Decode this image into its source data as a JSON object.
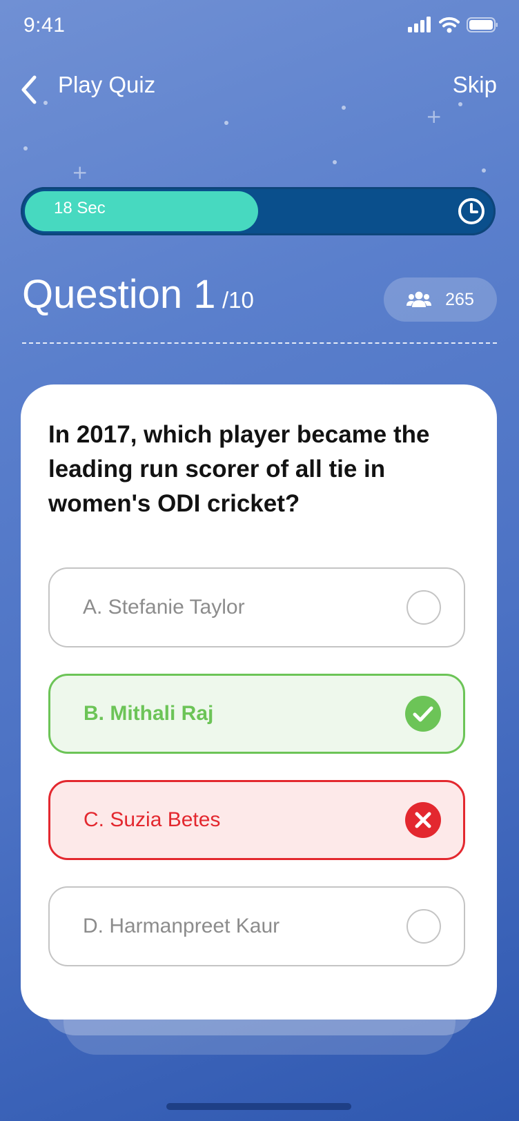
{
  "status_bar": {
    "time": "9:41"
  },
  "header": {
    "title": "Play Quiz",
    "skip_label": "Skip"
  },
  "timer": {
    "label": "18 Sec",
    "progress_fraction": 0.5
  },
  "question_header": {
    "title": "Question 1",
    "total": "/10",
    "players_count": "265"
  },
  "question": {
    "text": "In 2017, which player became the leading run scorer of all tie in women's ODI cricket?",
    "options": [
      {
        "label": "A. Stefanie Taylor",
        "state": "unselected"
      },
      {
        "label": "B. Mithali Raj",
        "state": "correct"
      },
      {
        "label": "C. Suzia Betes",
        "state": "wrong"
      },
      {
        "label": "D. Harmanpreet Kaur",
        "state": "unselected"
      }
    ]
  },
  "colors": {
    "timer_fill": "#47d9c0",
    "timer_track": "#0a4f8c",
    "correct": "#6cc457",
    "wrong": "#e3282f"
  },
  "icons": {
    "back": "chevron-left-icon",
    "clock": "clock-icon",
    "players": "users-icon",
    "correct": "check-circle-icon",
    "wrong": "x-circle-icon",
    "unselected": "empty-circle-icon"
  }
}
